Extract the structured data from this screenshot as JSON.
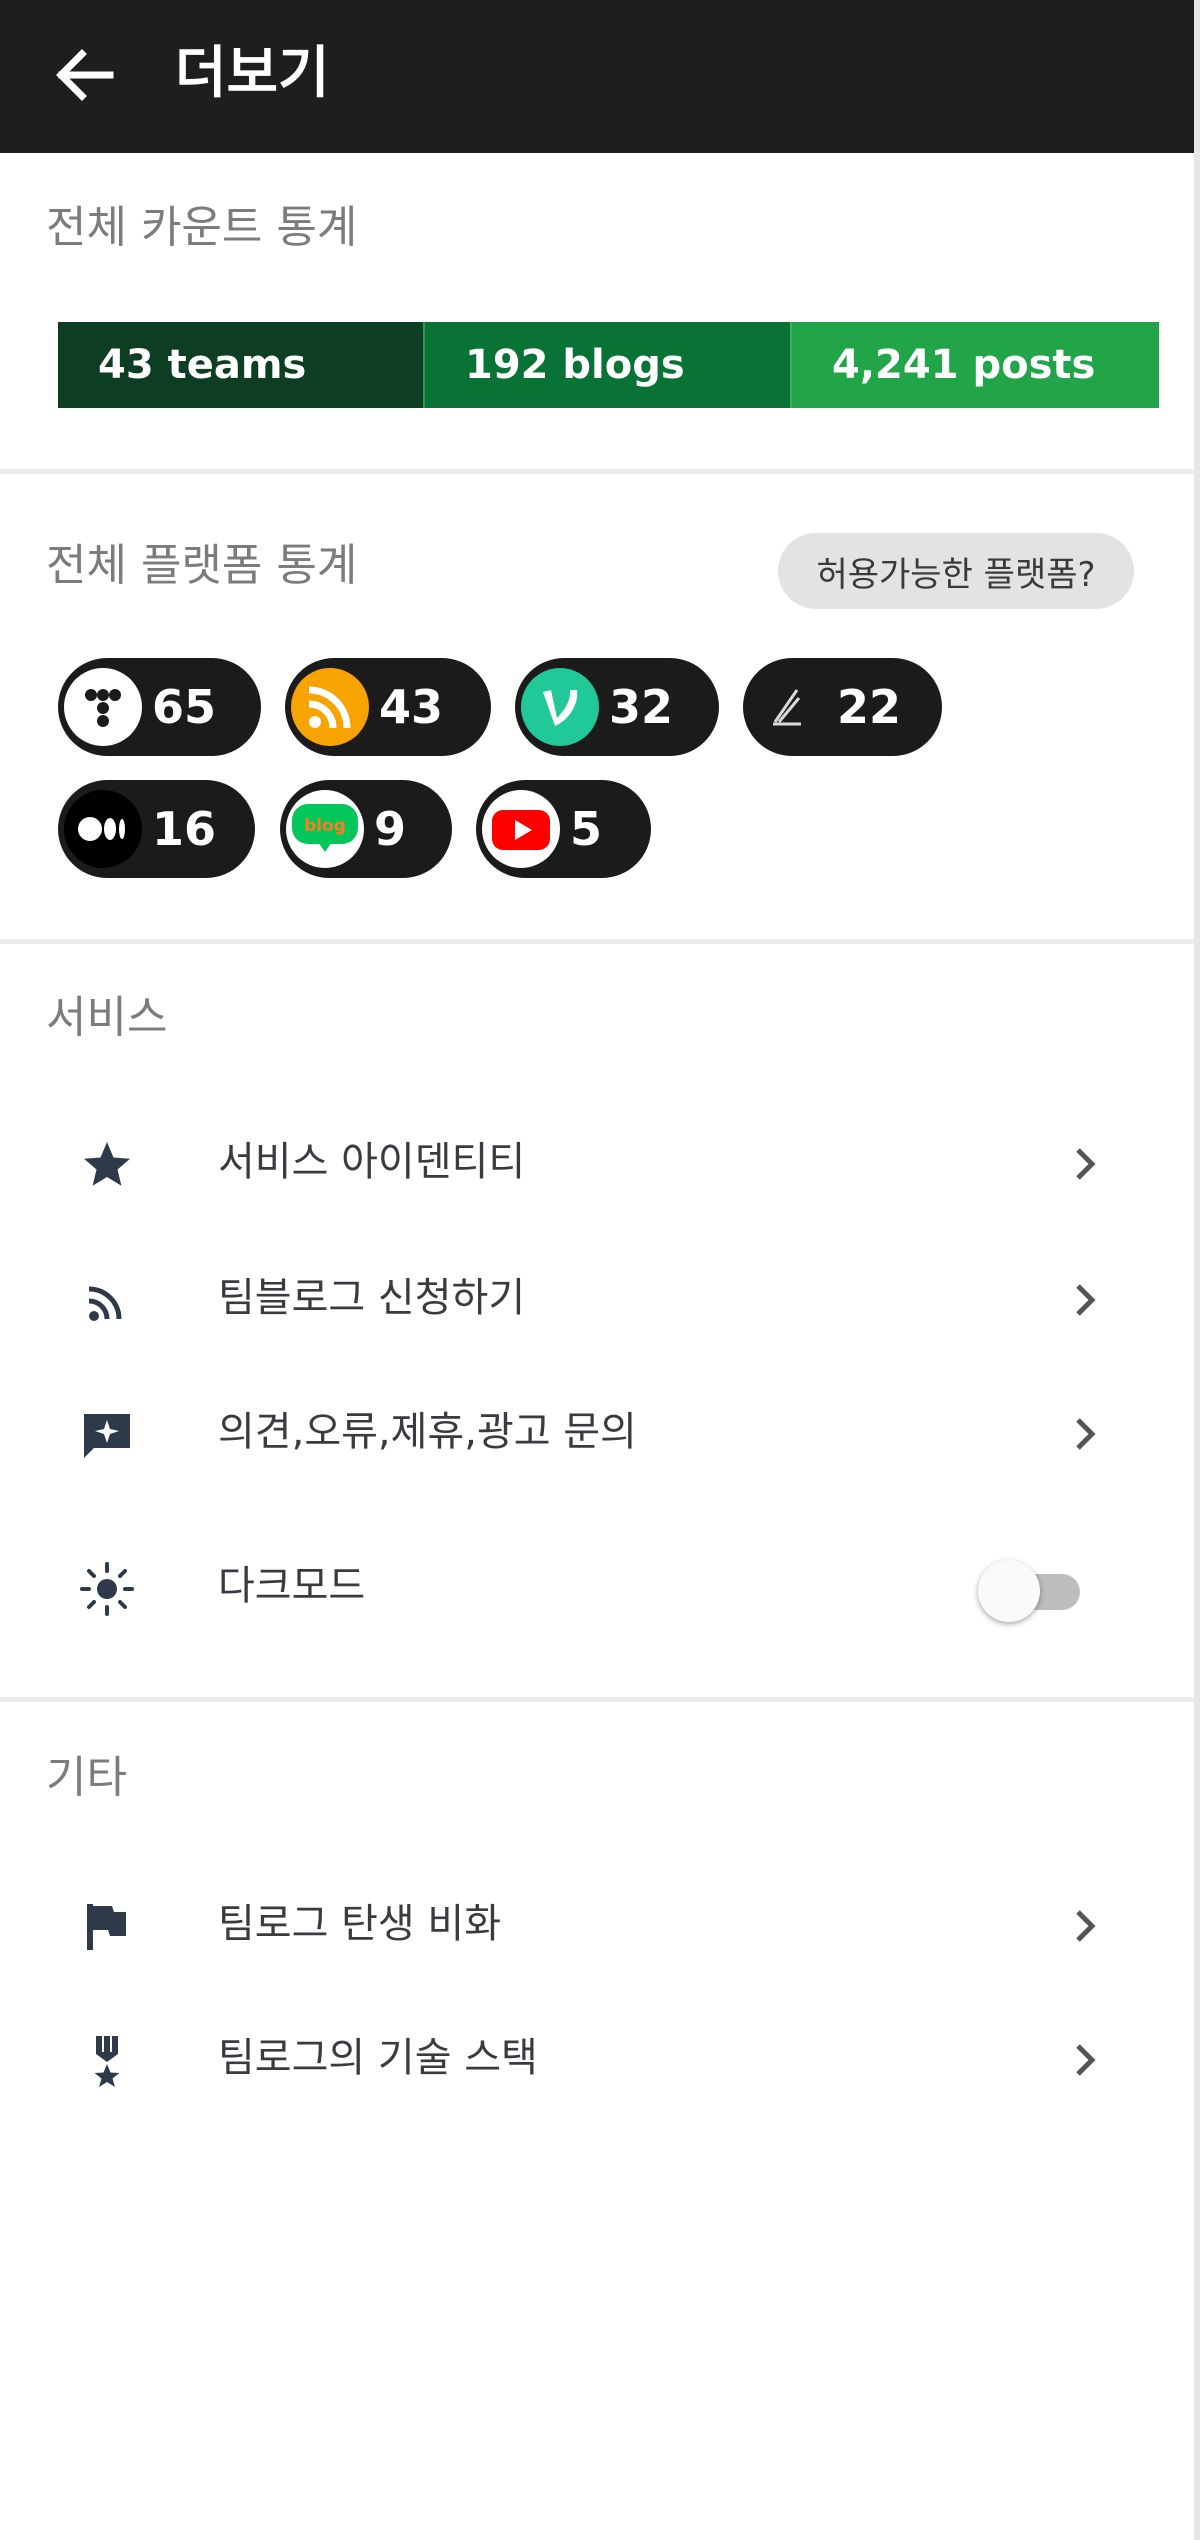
{
  "header": {
    "title": "더보기",
    "back_icon": "arrow-left-icon"
  },
  "count_stats": {
    "title": "전체 카운트 통계",
    "segments": [
      {
        "label": "43 teams",
        "color": "#0d3d22"
      },
      {
        "label": "192 blogs",
        "color": "#097335"
      },
      {
        "label": "4,241 posts",
        "color": "#22a449"
      }
    ]
  },
  "platform_stats": {
    "title": "전체 플랫폼 통계",
    "help_button": "허용가능한 플랫폼?",
    "platforms": [
      {
        "icon": "tistory-icon",
        "count": "65"
      },
      {
        "icon": "rss-icon",
        "count": "43"
      },
      {
        "icon": "velog-icon",
        "count": "32"
      },
      {
        "icon": "brunch-icon",
        "count": "22"
      },
      {
        "icon": "medium-icon",
        "count": "16"
      },
      {
        "icon": "naver-blog-icon",
        "count": "9"
      },
      {
        "icon": "youtube-icon",
        "count": "5"
      }
    ]
  },
  "services": {
    "title": "서비스",
    "items": [
      {
        "icon": "star-icon",
        "label": "서비스 아이덴티티"
      },
      {
        "icon": "rss-feed-icon",
        "label": "팀블로그 신청하기"
      },
      {
        "icon": "feedback-icon",
        "label": "의견,오류,제휴,광고 문의"
      },
      {
        "icon": "sun-icon",
        "label": "다크모드"
      }
    ],
    "dark_mode_enabled": false
  },
  "etc": {
    "title": "기타",
    "items": [
      {
        "icon": "flag-icon",
        "label": "팀로그 탄생 비화"
      },
      {
        "icon": "award-icon",
        "label": "팀로그의 기술 스택"
      }
    ]
  },
  "colors": {
    "header_bg": "#1e1e1e",
    "chip_bg": "#1b1b1b",
    "icon": "#2e3a4a"
  }
}
